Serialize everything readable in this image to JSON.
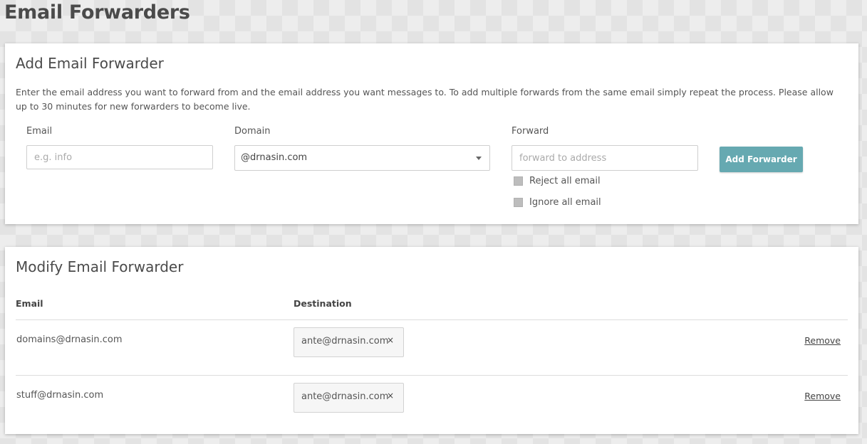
{
  "page": {
    "title": "Email Forwarders"
  },
  "add_card": {
    "title": "Add Email Forwarder",
    "description": "Enter the email address you want to forward from and the email address you want messages to. To add multiple forwards from the same email simply repeat the process. Please allow up to 30 minutes for new forwarders to become live.",
    "email_label": "Email",
    "email_placeholder": "e.g. info",
    "domain_label": "Domain",
    "domain_value": "@drnasin.com",
    "forward_label": "Forward",
    "forward_placeholder": "forward to address",
    "add_button_label": "Add Forwarder",
    "reject_label": "Reject all email",
    "ignore_label": "Ignore all email",
    "accent_color": "#66a9b1"
  },
  "modify_card": {
    "title": "Modify Email Forwarder",
    "col_email": "Email",
    "col_destination": "Destination",
    "rows": [
      {
        "email": "domains@drnasin.com",
        "destination": "ante@drnasin.com",
        "remove_label": "Remove"
      },
      {
        "email": "stuff@drnasin.com",
        "destination": "ante@drnasin.com",
        "remove_label": "Remove"
      }
    ],
    "chip_close_glyph": "×"
  }
}
